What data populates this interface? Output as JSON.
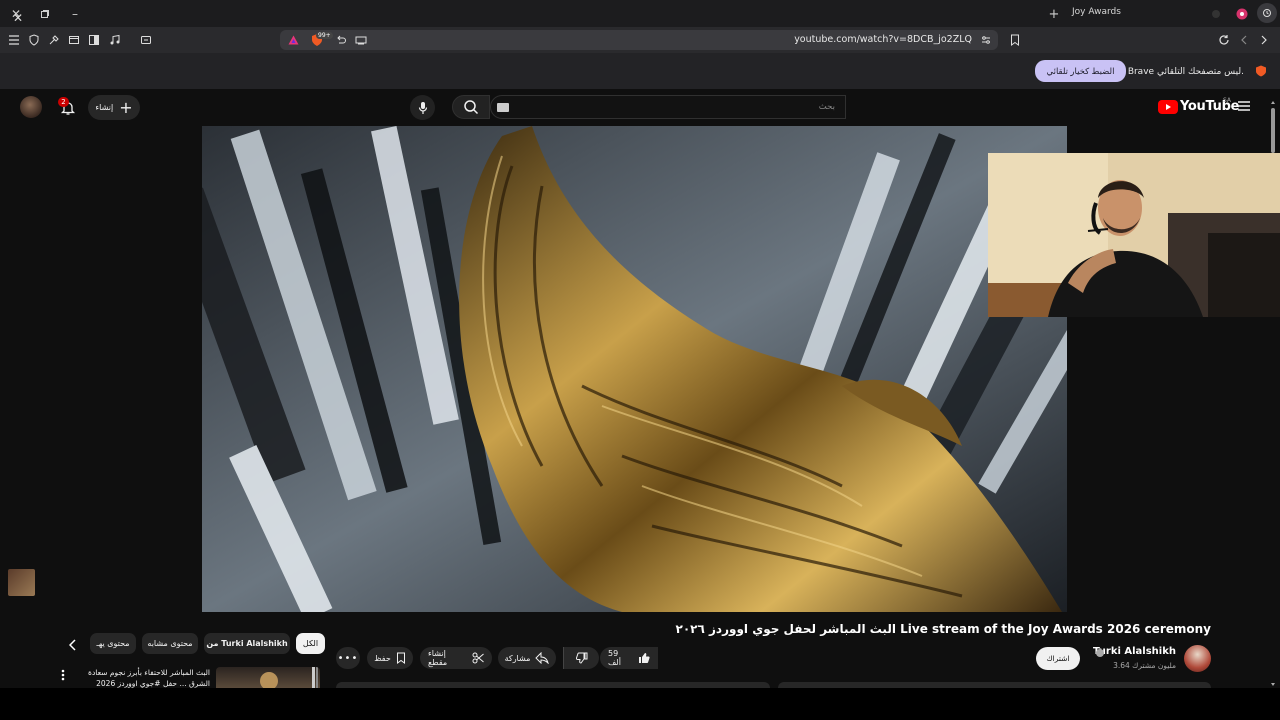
{
  "browser": {
    "tab_title": "Joy Awards",
    "url": "youtube.com/watch?v=8DCB_jo2ZLQ",
    "shield_count": "99+",
    "infobar": {
      "message": "Brave ليس متصفحك التلقائي.",
      "button": "الضبط كخيار تلقائي"
    }
  },
  "youtube": {
    "logo_text": "YouTube",
    "region": "SA",
    "search_placeholder": "بحث",
    "create_label": "إنشاء",
    "notification_count": "2"
  },
  "video": {
    "title": "البث المباشر لحفل جوي اووردز ٢٠٢٦ Live stream of the Joy Awards 2026 ceremony",
    "channel_name": "Turki Alalshikh",
    "subscribers": "3.64 مليون مشترك",
    "subscribe_label": "اشتراك",
    "likes": "59 ألف",
    "share_label": "مشاركة",
    "clip_label": "إنشاء مقطع",
    "save_label": "حفظ"
  },
  "chips": {
    "all": "الكل",
    "from_channel": "من Turki Alalshikh",
    "related": "محتوى مشابه",
    "more": "محتوى يهـ"
  },
  "recommendation": {
    "title": "البث المباشر للاحتفاء بأبرز نجوم سعادة الشرق ... حفل #جوي اووردز 2026"
  },
  "colors": {
    "background": "#0f0f0f",
    "yt_red": "#ff0000",
    "infobar_button": "#c9c2f5",
    "badge": "#cc0000"
  }
}
